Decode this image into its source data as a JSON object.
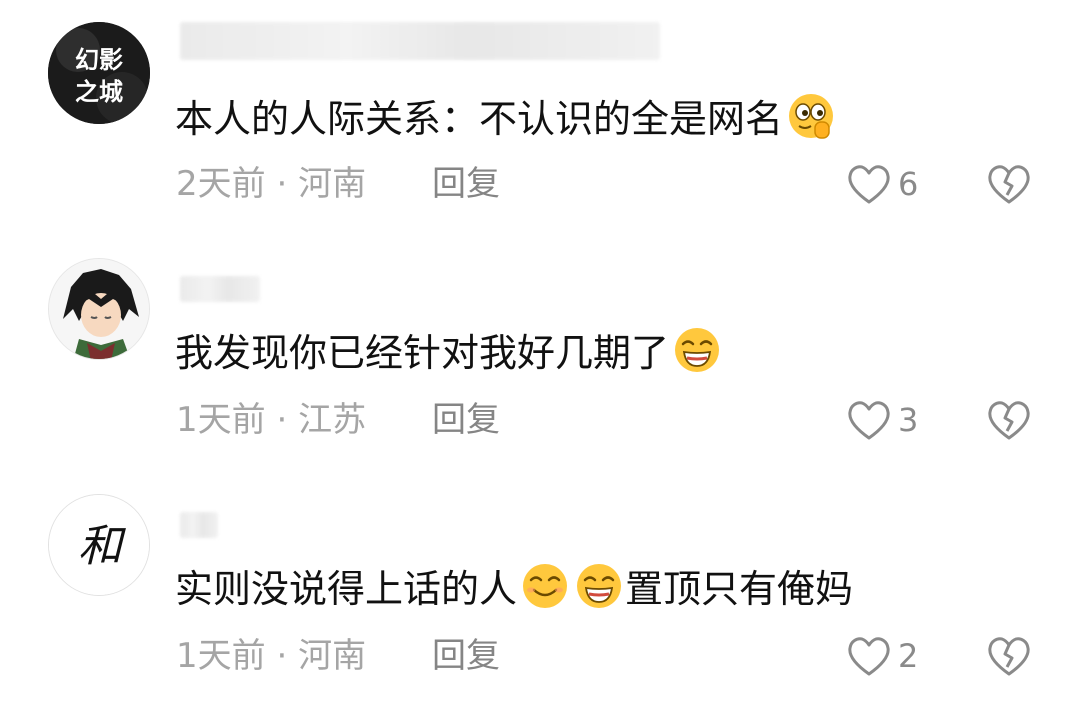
{
  "comments": [
    {
      "avatar_text": "幻影之城",
      "text": "本人的人际关系：不认识的全是网名",
      "emojis": [
        "peeking-hand-face"
      ],
      "time": "2天前",
      "separator": "·",
      "location": "河南",
      "reply_label": "回复",
      "like_count": "6"
    },
    {
      "avatar_text": "",
      "text": "我发现你已经针对我好几期了",
      "emojis": [
        "grinning-face"
      ],
      "time": "1天前",
      "separator": "·",
      "location": "江苏",
      "reply_label": "回复",
      "like_count": "3"
    },
    {
      "avatar_text": "和",
      "text_before": "实则没说得上话的人",
      "text_after": "置顶只有俺妈",
      "emojis": [
        "smiling-face",
        "grinning-face"
      ],
      "time": "1天前",
      "separator": "·",
      "location": "河南",
      "reply_label": "回复",
      "like_count": "2"
    }
  ],
  "icons": {
    "like": "heart-outline-icon",
    "dislike": "broken-heart-icon"
  },
  "colors": {
    "text": "#111111",
    "meta": "#a5a5a5",
    "emoji": "#ffc83d"
  }
}
